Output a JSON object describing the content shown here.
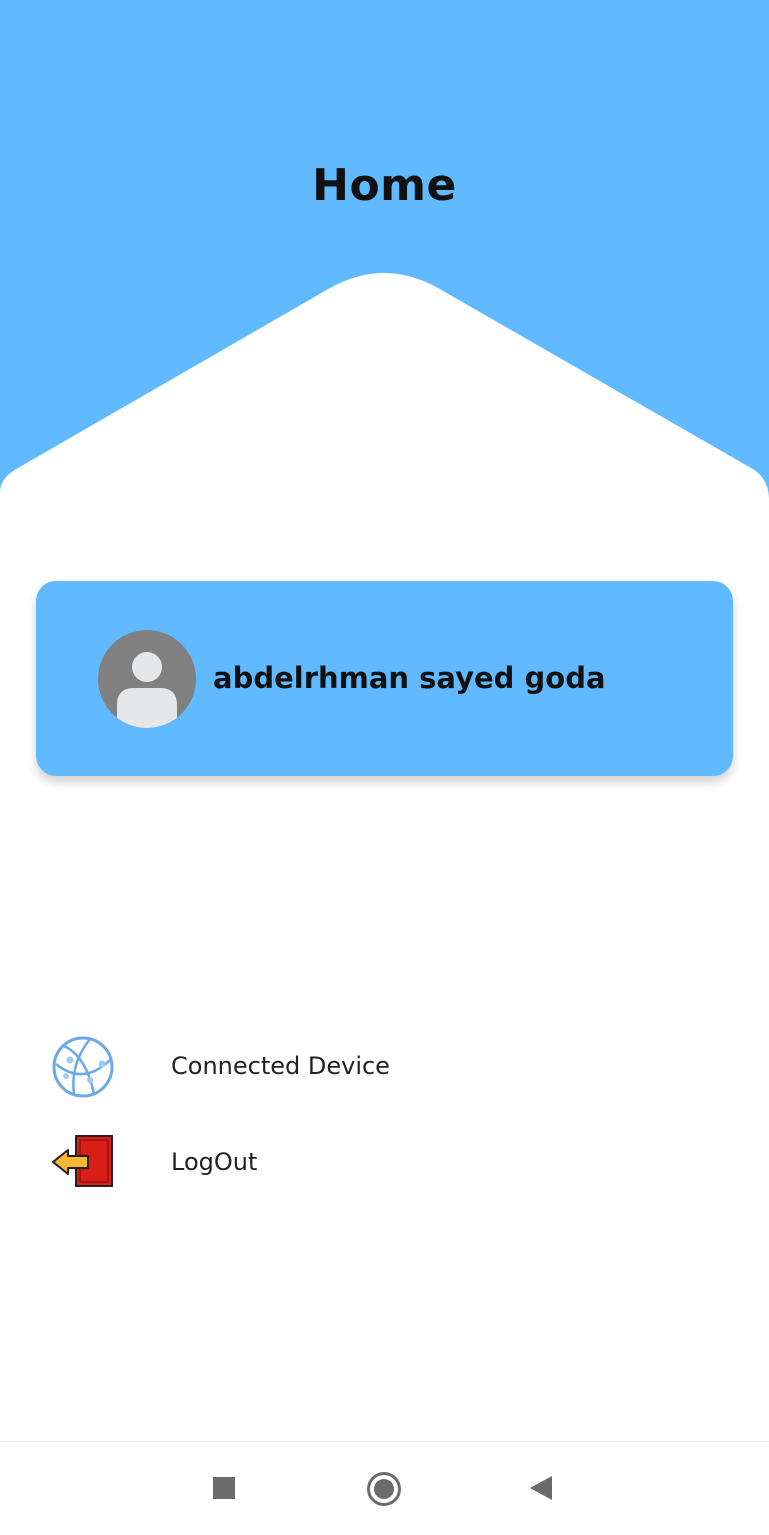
{
  "app": {
    "title": "Home"
  },
  "colors": {
    "header_blue": "#61baff",
    "card_blue": "#61baff",
    "avatar_gray": "#808080"
  },
  "profile": {
    "name": "abdelrhman sayed goda",
    "avatar_icon": "person-icon"
  },
  "menu": {
    "items": [
      {
        "label": "Connected Device",
        "icon": "globe-network-icon"
      },
      {
        "label": "LogOut",
        "icon": "logout-door-icon"
      }
    ]
  },
  "navigation_bar": {
    "buttons": [
      {
        "icon": "recents-square-icon"
      },
      {
        "icon": "home-circle-icon"
      },
      {
        "icon": "back-triangle-icon"
      }
    ]
  }
}
